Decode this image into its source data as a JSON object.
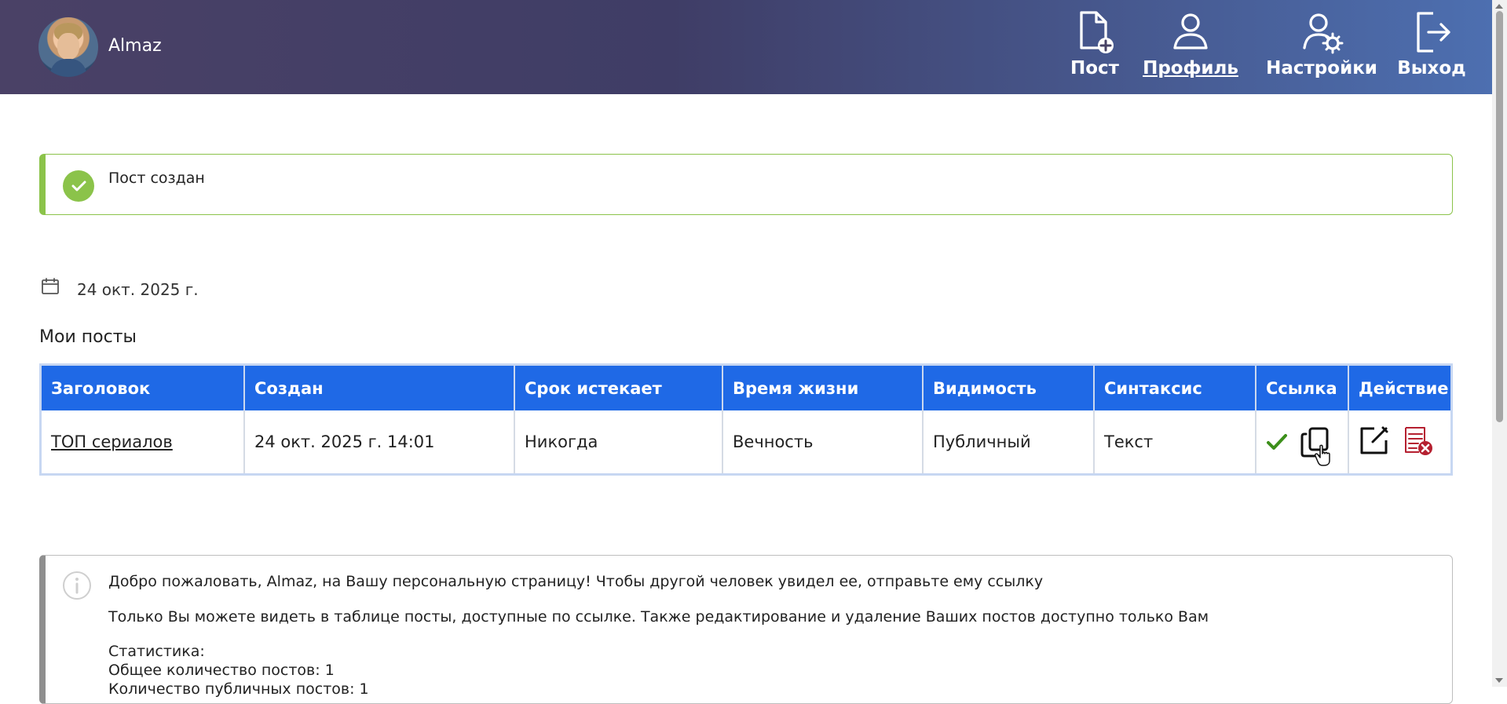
{
  "header": {
    "user_name": "Almaz",
    "nav": [
      {
        "label": "Пост",
        "icon": "document-plus-icon"
      },
      {
        "label": "Профиль",
        "icon": "user-icon"
      },
      {
        "label": "Настройки",
        "icon": "user-settings-icon"
      },
      {
        "label": "Выход",
        "icon": "logout-icon"
      }
    ]
  },
  "alert": {
    "message": "Пост создан",
    "color": "#8bc34a"
  },
  "date": {
    "value": "24 окт. 2025 г."
  },
  "section": {
    "title": "Мои посты"
  },
  "table": {
    "columns": [
      "Заголовок",
      "Создан",
      "Срок истекает",
      "Время жизни",
      "Видимость",
      "Синтаксис",
      "Ссылка",
      "Действие"
    ],
    "rows": [
      {
        "title": "ТОП сериалов",
        "created": "24 окт. 2025 г. 14:01",
        "expires": "Никогда",
        "lifetime": "Вечность",
        "visibility": "Публичный",
        "syntax": "Текст"
      }
    ],
    "header_color": "#1f69e6"
  },
  "info": {
    "line1": "Добро пожаловать, Almaz, на Вашу персональную страницу! Чтобы другой человек увидел ее, отправьте ему ссылку",
    "line2": "Только Вы можете видеть в таблице посты, доступные по ссылке. Также редактирование и удаление Ваших постов доступно только Вам",
    "stats_title": "Статистика:",
    "total_posts": "Общее количество постов: 1",
    "public_posts": "Количество публичных постов: 1"
  }
}
